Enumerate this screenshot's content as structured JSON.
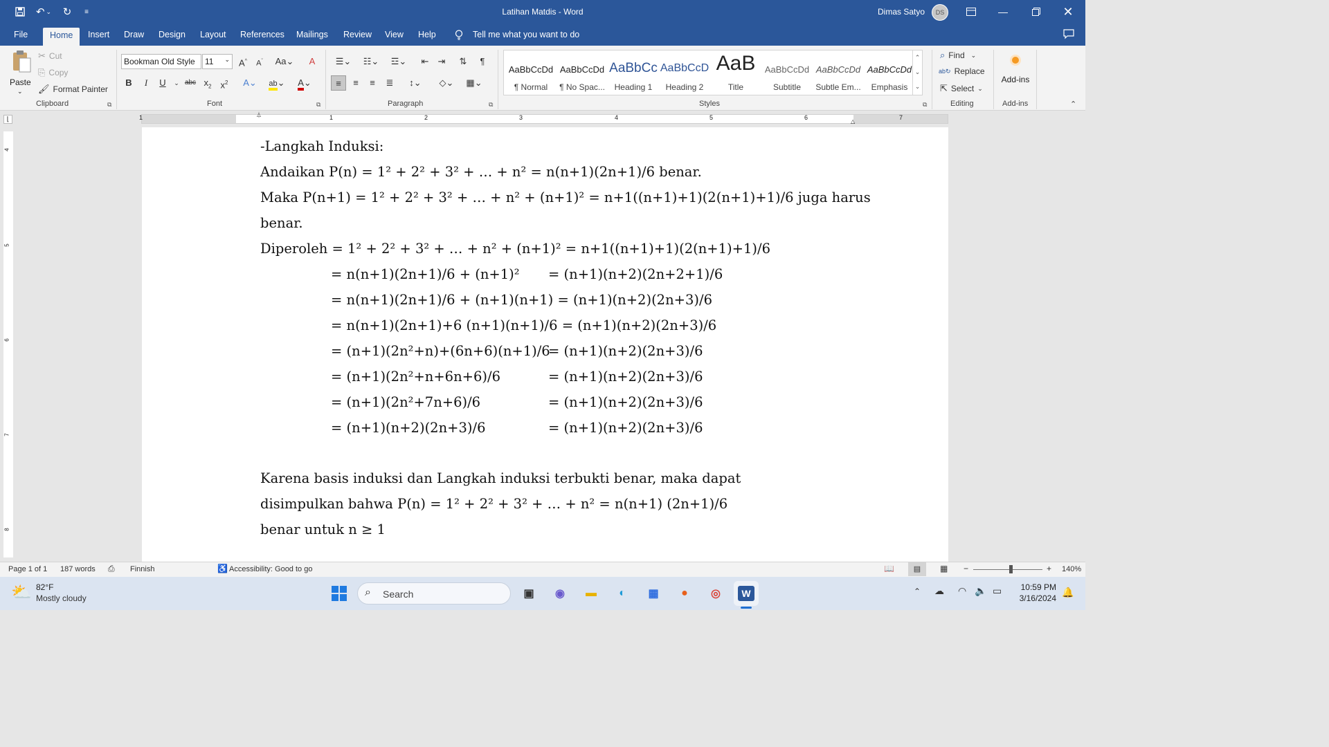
{
  "titlebar": {
    "document_title": "Latihan Matdis  -  Word",
    "user_name": "Dimas Satyo",
    "user_initials": "DS"
  },
  "tabs": [
    "File",
    "Home",
    "Insert",
    "Draw",
    "Design",
    "Layout",
    "References",
    "Mailings",
    "Review",
    "View",
    "Help"
  ],
  "tell_me": "Tell me what you want to do",
  "clipboard": {
    "paste": "Paste",
    "cut": "Cut",
    "copy": "Copy",
    "format_painter": "Format Painter",
    "label": "Clipboard"
  },
  "font": {
    "family": "Bookman Old Style",
    "size": "11",
    "label": "Font"
  },
  "paragraph": {
    "label": "Paragraph"
  },
  "styles": {
    "label": "Styles",
    "items": [
      {
        "sample": "AaBbCcDd",
        "name": "¶ Normal"
      },
      {
        "sample": "AaBbCcDd",
        "name": "¶ No Spac..."
      },
      {
        "sample": "AaBbCc",
        "name": "Heading 1"
      },
      {
        "sample": "AaBbCcD",
        "name": "Heading 2"
      },
      {
        "sample": "AaB",
        "name": "Title"
      },
      {
        "sample": "AaBbCcDd",
        "name": "Subtitle"
      },
      {
        "sample": "AaBbCcDd",
        "name": "Subtle Em..."
      },
      {
        "sample": "AaBbCcDd",
        "name": "Emphasis"
      }
    ]
  },
  "editing": {
    "find": "Find",
    "replace": "Replace",
    "select": "Select",
    "label": "Editing"
  },
  "addins": {
    "button": "Add-ins",
    "label": "Add-ins"
  },
  "ruler_numbers": [
    "1",
    "1",
    "2",
    "3",
    "4",
    "5",
    "6",
    "7"
  ],
  "vruler_numbers": [
    "4",
    "5",
    "6",
    "7",
    "8"
  ],
  "document": {
    "lines": [
      "-Langkah Induksi:",
      "Andaikan P(n) = 1² + 2² + 3² + … + n² = n(n+1)(2n+1)/6 benar.",
      "Maka P(n+1) = 1² + 2² + 3² + … + n² + (n+1)² = n+1((n+1)+1)(2(n+1)+1)/6 juga harus",
      "benar.",
      "Diperoleh = 1² + 2² + 3² + … + n² + (n+1)² = n+1((n+1)+1)(2(n+1)+1)/6"
    ],
    "derivation": [
      {
        "left": "= n(n+1)(2n+1)/6 + (n+1)²",
        "right": "= (n+1)(n+2)(2n+2+1)/6"
      },
      {
        "left": "= n(n+1)(2n+1)/6 + (n+1)(n+1) = (n+1)(n+2)(2n+3)/6",
        "right": ""
      },
      {
        "left": "= n(n+1)(2n+1)+6 (n+1)(n+1)/6 = (n+1)(n+2)(2n+3)/6",
        "right": ""
      },
      {
        "left": "= (n+1)(2n²+n)+(6n+6)(n+1)/6",
        "right": "= (n+1)(n+2)(2n+3)/6"
      },
      {
        "left": "= (n+1)(2n²+n+6n+6)/6",
        "right": "= (n+1)(n+2)(2n+3)/6"
      },
      {
        "left": "= (n+1)(2n²+7n+6)/6",
        "right": "= (n+1)(n+2)(2n+3)/6"
      },
      {
        "left": "= (n+1)(n+2)(2n+3)/6",
        "right": "= (n+1)(n+2)(2n+3)/6"
      }
    ],
    "conclusion": [
      "Karena basis induksi dan Langkah induksi terbukti benar, maka dapat",
      "disimpulkan bahwa P(n) = 1² + 2² + 3² + … + n² = n(n+1) (2n+1)/6",
      "benar untuk n ≥ 1"
    ]
  },
  "statusbar": {
    "page": "Page 1 of 1",
    "words": "187 words",
    "language": "Finnish",
    "accessibility": "Accessibility: Good to go",
    "zoom": "140%"
  },
  "taskbar": {
    "temperature": "82°F",
    "weather": "Mostly cloudy",
    "search": "Search",
    "time": "10:59 PM",
    "date": "3/16/2024"
  },
  "colors": {
    "word_blue": "#2b579a",
    "ribbon_bg": "#f3f3f3",
    "taskbar_bg": "#dbe4f1"
  }
}
